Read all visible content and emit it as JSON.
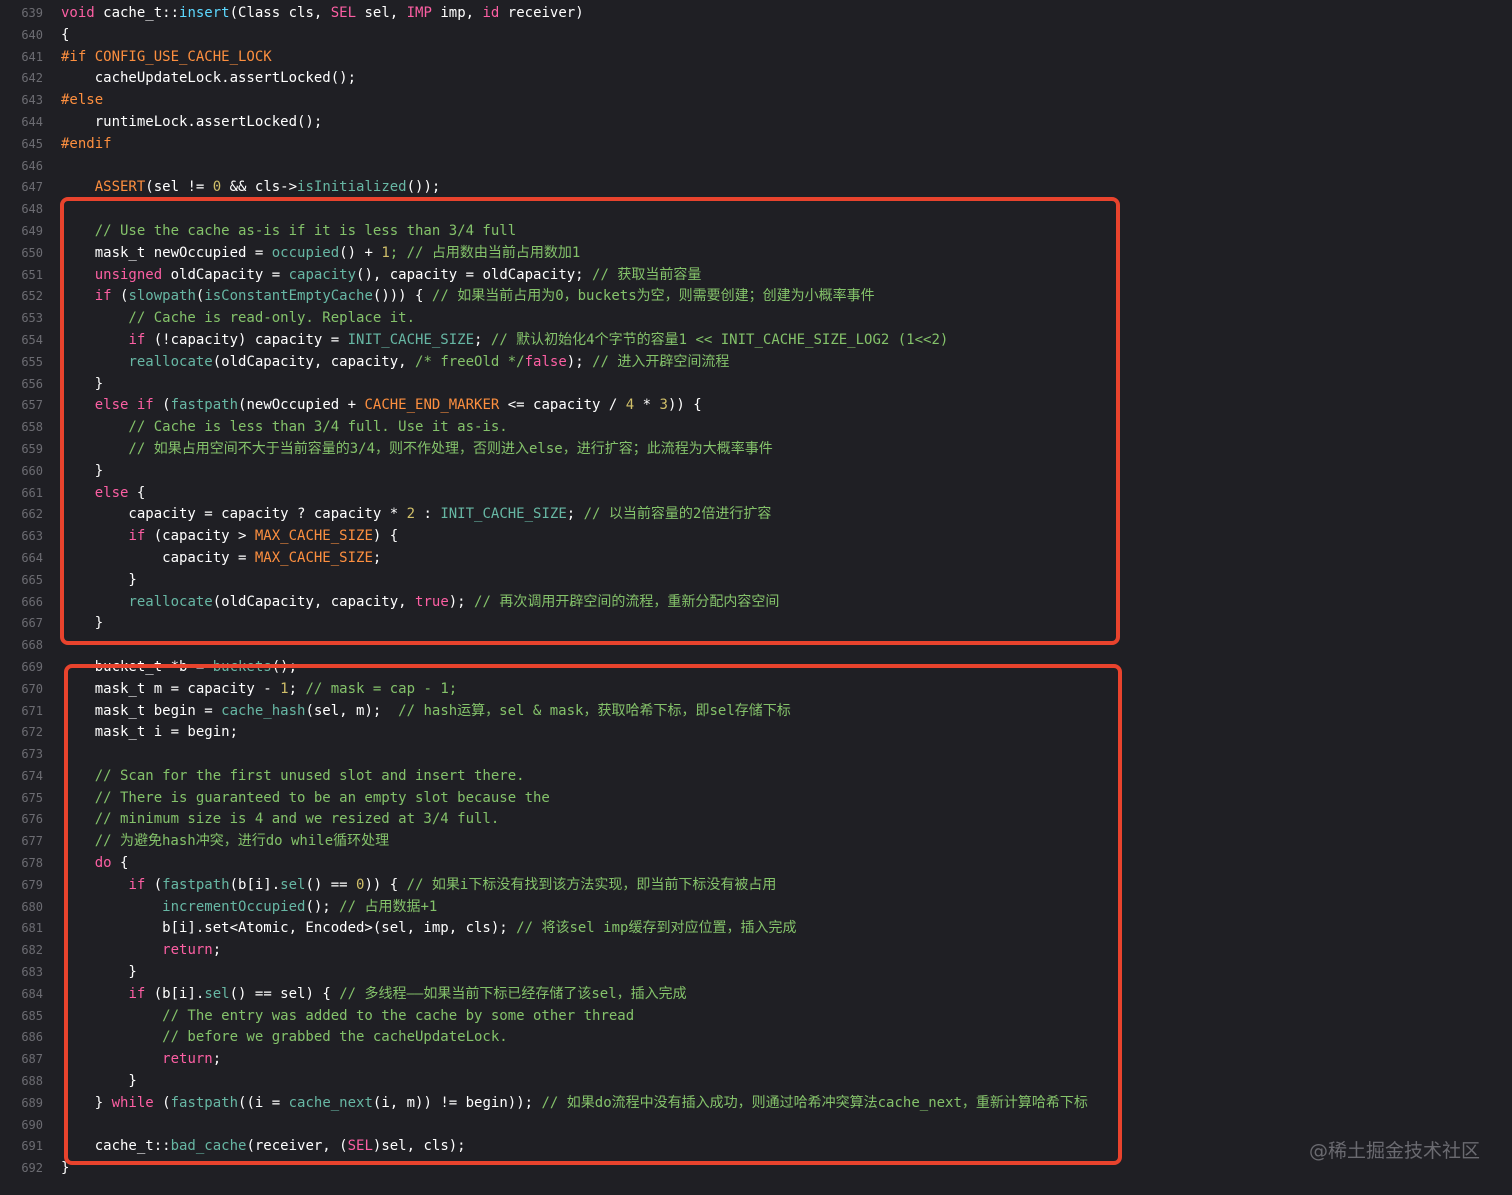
{
  "colors": {
    "background": "#1f1f24",
    "line_number": "#6c6c72",
    "keyword": "#fc5fa3",
    "comment": "#7f8c98",
    "number": "#d0bf69",
    "highlight_box": "#e8432d"
  },
  "watermark": "@稀土掘金技术社区",
  "code": {
    "lines": [
      {
        "no": "639",
        "tokens": [
          {
            "t": "void",
            "c": "kw"
          },
          {
            "t": " cache_t::",
            "c": "plain"
          },
          {
            "t": "insert",
            "c": "fn2"
          },
          {
            "t": "(Class cls, ",
            "c": "plain"
          },
          {
            "t": "SEL",
            "c": "kw"
          },
          {
            "t": " sel, ",
            "c": "plain"
          },
          {
            "t": "IMP",
            "c": "kw"
          },
          {
            "t": " imp, ",
            "c": "plain"
          },
          {
            "t": "id",
            "c": "kw"
          },
          {
            "t": " receiver)",
            "c": "plain"
          }
        ]
      },
      {
        "no": "640",
        "tokens": [
          {
            "t": "{",
            "c": "plain"
          }
        ]
      },
      {
        "no": "641",
        "tokens": [
          {
            "t": "#if CONFIG_USE_CACHE_LOCK",
            "c": "macro"
          }
        ]
      },
      {
        "no": "642",
        "tokens": [
          {
            "t": "    cacheUpdateLock.assertLocked();",
            "c": "plain"
          }
        ]
      },
      {
        "no": "643",
        "tokens": [
          {
            "t": "#else",
            "c": "macro"
          }
        ]
      },
      {
        "no": "644",
        "tokens": [
          {
            "t": "    runtimeLock.assertLocked();",
            "c": "plain"
          }
        ]
      },
      {
        "no": "645",
        "tokens": [
          {
            "t": "#endif",
            "c": "macro"
          }
        ]
      },
      {
        "no": "646",
        "tokens": []
      },
      {
        "no": "647",
        "tokens": [
          {
            "t": "    ",
            "c": "plain"
          },
          {
            "t": "ASSERT",
            "c": "macro"
          },
          {
            "t": "(sel != ",
            "c": "plain"
          },
          {
            "t": "0",
            "c": "num"
          },
          {
            "t": " && cls->",
            "c": "plain"
          },
          {
            "t": "isInitialized",
            "c": "call"
          },
          {
            "t": "());",
            "c": "plain"
          }
        ]
      },
      {
        "no": "648",
        "tokens": []
      },
      {
        "no": "649",
        "tokens": [
          {
            "t": "    // Use the cache as-is if it is less than 3/4 full",
            "c": "green"
          }
        ]
      },
      {
        "no": "650",
        "tokens": [
          {
            "t": "    mask_t ",
            "c": "plain"
          },
          {
            "t": "newOccupied = ",
            "c": "plain"
          },
          {
            "t": "occupied",
            "c": "call"
          },
          {
            "t": "() + ",
            "c": "plain"
          },
          {
            "t": "1",
            "c": "num"
          },
          {
            "t": "; // 占用数由当前占用数加1",
            "c": "green"
          }
        ]
      },
      {
        "no": "651",
        "tokens": [
          {
            "t": "    ",
            "c": "plain"
          },
          {
            "t": "unsigned",
            "c": "kw"
          },
          {
            "t": " oldCapacity = ",
            "c": "plain"
          },
          {
            "t": "capacity",
            "c": "call"
          },
          {
            "t": "(), capacity = oldCapacity; ",
            "c": "plain"
          },
          {
            "t": "// 获取当前容量",
            "c": "green"
          }
        ]
      },
      {
        "no": "652",
        "tokens": [
          {
            "t": "    ",
            "c": "plain"
          },
          {
            "t": "if",
            "c": "kw"
          },
          {
            "t": " (",
            "c": "plain"
          },
          {
            "t": "slowpath",
            "c": "call"
          },
          {
            "t": "(",
            "c": "plain"
          },
          {
            "t": "isConstantEmptyCache",
            "c": "call"
          },
          {
            "t": "())) { ",
            "c": "plain"
          },
          {
            "t": "// 如果当前占用为0，buckets为空，则需要创建；创建为小概率事件",
            "c": "green"
          }
        ]
      },
      {
        "no": "653",
        "tokens": [
          {
            "t": "        // Cache is read-only. Replace it.",
            "c": "green"
          }
        ]
      },
      {
        "no": "654",
        "tokens": [
          {
            "t": "        ",
            "c": "plain"
          },
          {
            "t": "if",
            "c": "kw"
          },
          {
            "t": " (!capacity) capacity = ",
            "c": "plain"
          },
          {
            "t": "INIT_CACHE_SIZE",
            "c": "call"
          },
          {
            "t": "; ",
            "c": "plain"
          },
          {
            "t": "// 默认初始化4个字节的容量1 << INIT_CACHE_SIZE_LOG2 (1<<2)",
            "c": "green"
          }
        ]
      },
      {
        "no": "655",
        "tokens": [
          {
            "t": "        ",
            "c": "plain"
          },
          {
            "t": "reallocate",
            "c": "call"
          },
          {
            "t": "(oldCapacity, capacity, ",
            "c": "plain"
          },
          {
            "t": "/* freeOld */",
            "c": "green"
          },
          {
            "t": "false",
            "c": "kw"
          },
          {
            "t": "); ",
            "c": "plain"
          },
          {
            "t": "// 进入开辟空间流程",
            "c": "green"
          }
        ]
      },
      {
        "no": "656",
        "tokens": [
          {
            "t": "    }",
            "c": "plain"
          }
        ]
      },
      {
        "no": "657",
        "tokens": [
          {
            "t": "    ",
            "c": "plain"
          },
          {
            "t": "else if",
            "c": "kw"
          },
          {
            "t": " (",
            "c": "plain"
          },
          {
            "t": "fastpath",
            "c": "call"
          },
          {
            "t": "(newOccupied + ",
            "c": "plain"
          },
          {
            "t": "CACHE_END_MARKER",
            "c": "macro"
          },
          {
            "t": " <= capacity / ",
            "c": "plain"
          },
          {
            "t": "4",
            "c": "num"
          },
          {
            "t": " * ",
            "c": "plain"
          },
          {
            "t": "3",
            "c": "num"
          },
          {
            "t": ")) {",
            "c": "plain"
          }
        ]
      },
      {
        "no": "658",
        "tokens": [
          {
            "t": "        // Cache is less than 3/4 full. Use it as-is.",
            "c": "green"
          }
        ]
      },
      {
        "no": "659",
        "tokens": [
          {
            "t": "        // 如果占用空间不大于当前容量的3/4，则不作处理，否则进入else，进行扩容；此流程为大概率事件",
            "c": "green"
          }
        ]
      },
      {
        "no": "660",
        "tokens": [
          {
            "t": "    }",
            "c": "plain"
          }
        ]
      },
      {
        "no": "661",
        "tokens": [
          {
            "t": "    ",
            "c": "plain"
          },
          {
            "t": "else",
            "c": "kw"
          },
          {
            "t": " {",
            "c": "plain"
          }
        ]
      },
      {
        "no": "662",
        "tokens": [
          {
            "t": "        capacity = capacity ? capacity * ",
            "c": "plain"
          },
          {
            "t": "2",
            "c": "num"
          },
          {
            "t": " : ",
            "c": "plain"
          },
          {
            "t": "INIT_CACHE_SIZE",
            "c": "call"
          },
          {
            "t": "; ",
            "c": "plain"
          },
          {
            "t": "// 以当前容量的2倍进行扩容",
            "c": "green"
          }
        ]
      },
      {
        "no": "663",
        "tokens": [
          {
            "t": "        ",
            "c": "plain"
          },
          {
            "t": "if",
            "c": "kw"
          },
          {
            "t": " (capacity > ",
            "c": "plain"
          },
          {
            "t": "MAX_CACHE_SIZE",
            "c": "macro"
          },
          {
            "t": ") {",
            "c": "plain"
          }
        ]
      },
      {
        "no": "664",
        "tokens": [
          {
            "t": "            capacity = ",
            "c": "plain"
          },
          {
            "t": "MAX_CACHE_SIZE",
            "c": "macro"
          },
          {
            "t": ";",
            "c": "plain"
          }
        ]
      },
      {
        "no": "665",
        "tokens": [
          {
            "t": "        }",
            "c": "plain"
          }
        ]
      },
      {
        "no": "666",
        "tokens": [
          {
            "t": "        ",
            "c": "plain"
          },
          {
            "t": "reallocate",
            "c": "call"
          },
          {
            "t": "(oldCapacity, capacity, ",
            "c": "plain"
          },
          {
            "t": "true",
            "c": "kw"
          },
          {
            "t": "); ",
            "c": "plain"
          },
          {
            "t": "// 再次调用开辟空间的流程，重新分配内容空间",
            "c": "green"
          }
        ]
      },
      {
        "no": "667",
        "tokens": [
          {
            "t": "    }",
            "c": "plain"
          }
        ]
      },
      {
        "no": "668",
        "tokens": []
      },
      {
        "no": "669",
        "tokens": [
          {
            "t": "    bucket_t *b = ",
            "c": "plain"
          },
          {
            "t": "buckets",
            "c": "call"
          },
          {
            "t": "();",
            "c": "plain"
          }
        ]
      },
      {
        "no": "670",
        "tokens": [
          {
            "t": "    mask_t m = capacity - ",
            "c": "plain"
          },
          {
            "t": "1",
            "c": "num"
          },
          {
            "t": "; ",
            "c": "plain"
          },
          {
            "t": "// mask = cap - 1;",
            "c": "green"
          }
        ]
      },
      {
        "no": "671",
        "tokens": [
          {
            "t": "    mask_t begin = ",
            "c": "plain"
          },
          {
            "t": "cache_hash",
            "c": "call"
          },
          {
            "t": "(sel, m);  ",
            "c": "plain"
          },
          {
            "t": "// hash运算，sel & mask，获取哈希下标，即sel存储下标",
            "c": "green"
          }
        ]
      },
      {
        "no": "672",
        "tokens": [
          {
            "t": "    mask_t i = begin;",
            "c": "plain"
          }
        ]
      },
      {
        "no": "673",
        "tokens": []
      },
      {
        "no": "674",
        "tokens": [
          {
            "t": "    // Scan for the first unused slot and insert there.",
            "c": "green"
          }
        ]
      },
      {
        "no": "675",
        "tokens": [
          {
            "t": "    // There is guaranteed to be an empty slot because the",
            "c": "green"
          }
        ]
      },
      {
        "no": "676",
        "tokens": [
          {
            "t": "    // minimum size is 4 and we resized at 3/4 full.",
            "c": "green"
          }
        ]
      },
      {
        "no": "677",
        "tokens": [
          {
            "t": "    // 为避免hash冲突，进行do while循环处理",
            "c": "green"
          }
        ]
      },
      {
        "no": "678",
        "tokens": [
          {
            "t": "    ",
            "c": "plain"
          },
          {
            "t": "do",
            "c": "kw"
          },
          {
            "t": " {",
            "c": "plain"
          }
        ]
      },
      {
        "no": "679",
        "tokens": [
          {
            "t": "        ",
            "c": "plain"
          },
          {
            "t": "if",
            "c": "kw"
          },
          {
            "t": " (",
            "c": "plain"
          },
          {
            "t": "fastpath",
            "c": "call"
          },
          {
            "t": "(b[i].",
            "c": "plain"
          },
          {
            "t": "sel",
            "c": "call"
          },
          {
            "t": "() == ",
            "c": "plain"
          },
          {
            "t": "0",
            "c": "num"
          },
          {
            "t": ")) { ",
            "c": "plain"
          },
          {
            "t": "// 如果i下标没有找到该方法实现，即当前下标没有被占用",
            "c": "green"
          }
        ]
      },
      {
        "no": "680",
        "tokens": [
          {
            "t": "            ",
            "c": "plain"
          },
          {
            "t": "incrementOccupied",
            "c": "call"
          },
          {
            "t": "(); ",
            "c": "plain"
          },
          {
            "t": "// 占用数据+1",
            "c": "green"
          }
        ]
      },
      {
        "no": "681",
        "tokens": [
          {
            "t": "            b[i].set<Atomic, Encoded>(sel, imp, cls); ",
            "c": "plain"
          },
          {
            "t": "// 将该sel imp缓存到对应位置，插入完成",
            "c": "green"
          }
        ]
      },
      {
        "no": "682",
        "tokens": [
          {
            "t": "            ",
            "c": "plain"
          },
          {
            "t": "return",
            "c": "kw"
          },
          {
            "t": ";",
            "c": "plain"
          }
        ]
      },
      {
        "no": "683",
        "tokens": [
          {
            "t": "        }",
            "c": "plain"
          }
        ]
      },
      {
        "no": "684",
        "tokens": [
          {
            "t": "        ",
            "c": "plain"
          },
          {
            "t": "if",
            "c": "kw"
          },
          {
            "t": " (b[i].",
            "c": "plain"
          },
          {
            "t": "sel",
            "c": "call"
          },
          {
            "t": "() == sel) { ",
            "c": "plain"
          },
          {
            "t": "// 多线程——如果当前下标已经存储了该sel，插入完成",
            "c": "green"
          }
        ]
      },
      {
        "no": "685",
        "tokens": [
          {
            "t": "            // The entry was added to the cache by some other thread",
            "c": "green"
          }
        ]
      },
      {
        "no": "686",
        "tokens": [
          {
            "t": "            // before we grabbed the cacheUpdateLock.",
            "c": "green"
          }
        ]
      },
      {
        "no": "687",
        "tokens": [
          {
            "t": "            ",
            "c": "plain"
          },
          {
            "t": "return",
            "c": "kw"
          },
          {
            "t": ";",
            "c": "plain"
          }
        ]
      },
      {
        "no": "688",
        "tokens": [
          {
            "t": "        }",
            "c": "plain"
          }
        ]
      },
      {
        "no": "689",
        "tokens": [
          {
            "t": "    } ",
            "c": "plain"
          },
          {
            "t": "while",
            "c": "kw"
          },
          {
            "t": " (",
            "c": "plain"
          },
          {
            "t": "fastpath",
            "c": "call"
          },
          {
            "t": "((i = ",
            "c": "plain"
          },
          {
            "t": "cache_next",
            "c": "call"
          },
          {
            "t": "(i, m)) != begin)); ",
            "c": "plain"
          },
          {
            "t": "// 如果do流程中没有插入成功，则通过哈希冲突算法cache_next，重新计算哈希下标",
            "c": "green"
          }
        ]
      },
      {
        "no": "690",
        "tokens": []
      },
      {
        "no": "691",
        "tokens": [
          {
            "t": "    cache_t::",
            "c": "plain"
          },
          {
            "t": "bad_cache",
            "c": "call"
          },
          {
            "t": "(receiver, (",
            "c": "plain"
          },
          {
            "t": "SEL",
            "c": "kw"
          },
          {
            "t": ")sel, cls);",
            "c": "plain"
          }
        ]
      },
      {
        "no": "692",
        "tokens": [
          {
            "t": "}",
            "c": "plain"
          }
        ]
      }
    ]
  }
}
